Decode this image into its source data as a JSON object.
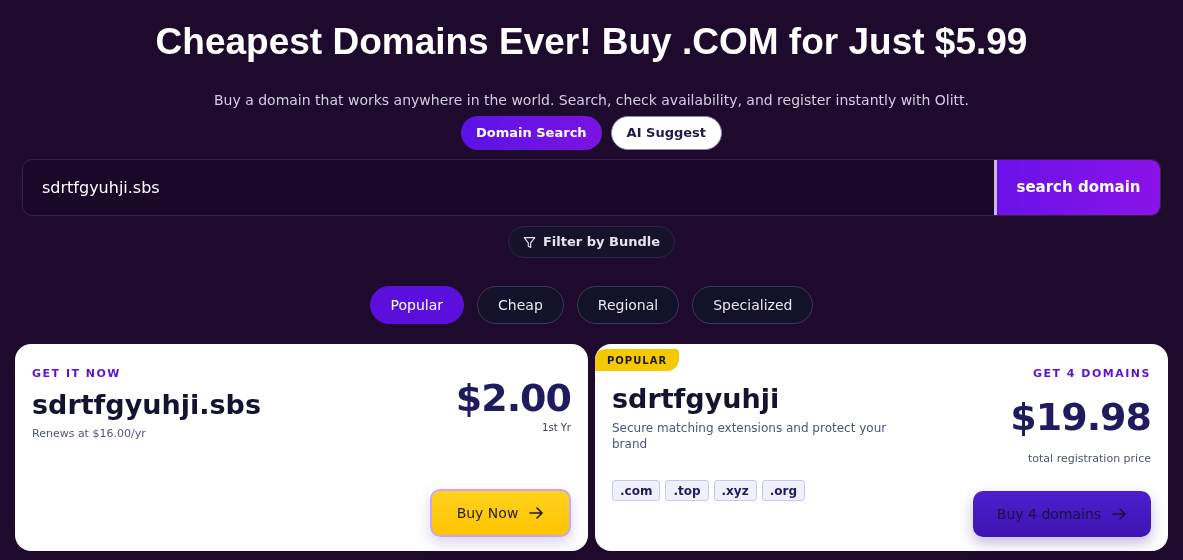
{
  "heading": "Cheapest Domains Ever! Buy .COM for Just $5.99",
  "subtitle": "Buy a domain that works anywhere in the world. Search, check availability, and register instantly with Olitt.",
  "modes": [
    {
      "label": "Domain Search",
      "selected": true
    },
    {
      "label": "AI Suggest",
      "selected": false
    }
  ],
  "search": {
    "value": "sdrtfgyuhji.sbs",
    "button": "search domain"
  },
  "filter_button": "Filter by Bundle",
  "categories": [
    {
      "label": "Popular",
      "selected": true
    },
    {
      "label": "Cheap",
      "selected": false
    },
    {
      "label": "Regional",
      "selected": false
    },
    {
      "label": "Specialized",
      "selected": false
    }
  ],
  "cards": [
    {
      "kind": "single",
      "eyebrow": "GET IT NOW",
      "domain": "sdrtfgyuhji.sbs",
      "renewal": "Renews at $16.00/yr",
      "price": "$2.00",
      "price_note": "1st Yr",
      "button": "Buy Now"
    },
    {
      "kind": "bundle",
      "badge": "POPULAR",
      "eyebrow": "GET 4 DOMAINS",
      "domain": "sdrtfgyuhji",
      "description": "Secure matching extensions and protect your brand",
      "extensions": [
        ".com",
        ".top",
        ".xyz",
        ".org"
      ],
      "price": "$19.98",
      "price_note": "total registration price",
      "button": "Buy 4 domains"
    }
  ]
}
